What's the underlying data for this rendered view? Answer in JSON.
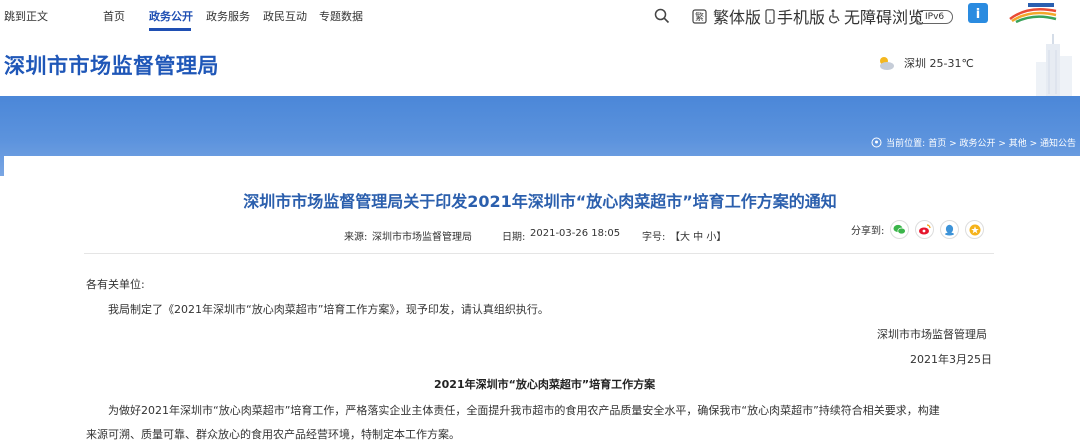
{
  "topbar": {
    "skip": "跳到正文",
    "nav": [
      "首页",
      "政务公开",
      "政务服务",
      "政民互动",
      "专题数据"
    ],
    "tools": {
      "traditional": "繁体版",
      "mobile": "手机版",
      "accessible": "无障碍浏览",
      "ipv6": "IPv6"
    }
  },
  "header": {
    "title": "深圳市市场监督管理局",
    "weather": "深圳 25-31℃"
  },
  "breadcrumb": {
    "label": "当前位置:",
    "path": "首页 > 政务公开 > 其他 > 通知公告"
  },
  "article": {
    "title": "深圳市市场监督管理局关于印发2021年深圳市“放心肉菜超市”培育工作方案的通知",
    "source_label": "来源:",
    "source": "深圳市市场监督管理局",
    "date_label": "日期:",
    "date": "2021-03-26 18:05",
    "font_label": "字号:",
    "font_sizes": "【大 中 小】",
    "share_label": "分享到:",
    "salutation": "各有关单位:",
    "body_1": "我局制定了《2021年深圳市“放心肉菜超市”培育工作方案》，现予印发，请认真组织执行。",
    "signer": "深圳市市场监督管理局",
    "sign_date": "2021年3月25日",
    "section_title": "2021年深圳市“放心肉菜超市”培育工作方案",
    "body_2": "为做好2021年深圳市“放心肉菜超市”培育工作，严格落实企业主体责任，全面提升我市超市的食用农产品质量安全水平，确保我市“放心肉菜超市”持续符合相关要求，构建",
    "body_3": "来源可溯、质量可靠、群众放心的食用农产品经营环境，特制定本工作方案。"
  },
  "colors": {
    "brand_blue": "#1f57b8",
    "title_blue": "#2b5fad",
    "banner_blue": "#5c93dd"
  }
}
